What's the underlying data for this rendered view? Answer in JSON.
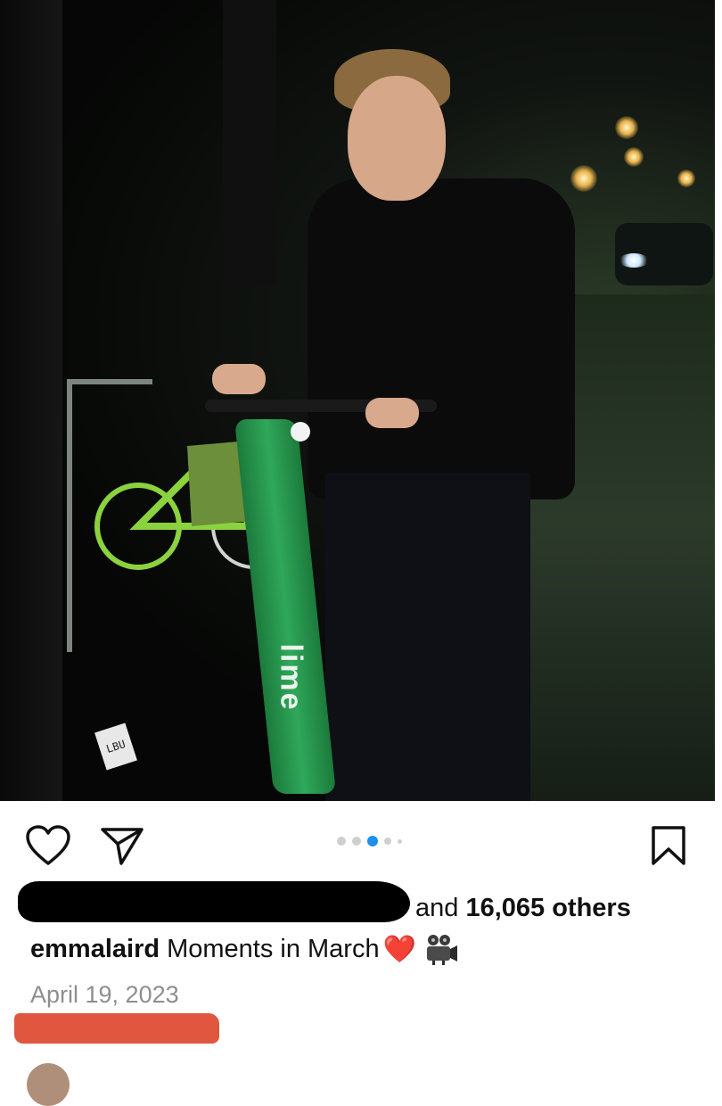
{
  "post": {
    "photo_alt": "",
    "carousel": {
      "count": 5,
      "active_index": 2
    },
    "likes": {
      "prefix": "and",
      "count_text": "16,065 others"
    },
    "caption": {
      "username": "emmalaird",
      "text": "Moments in March",
      "emoji_heart": "❤️"
    },
    "date": "April 19, 2023",
    "scooter_logo": "lime",
    "plate_text": "LBU"
  },
  "icons": {
    "like": "heart-outline-icon",
    "share": "paper-plane-icon",
    "save": "bookmark-icon",
    "camera": "movie-camera-icon"
  },
  "colors": {
    "active_dot": "#1d8ff0",
    "inactive_dot": "#cfcfcf",
    "date_text": "#8e8e8e",
    "redaction_red": "#e0563f",
    "redaction_black": "#000000"
  }
}
